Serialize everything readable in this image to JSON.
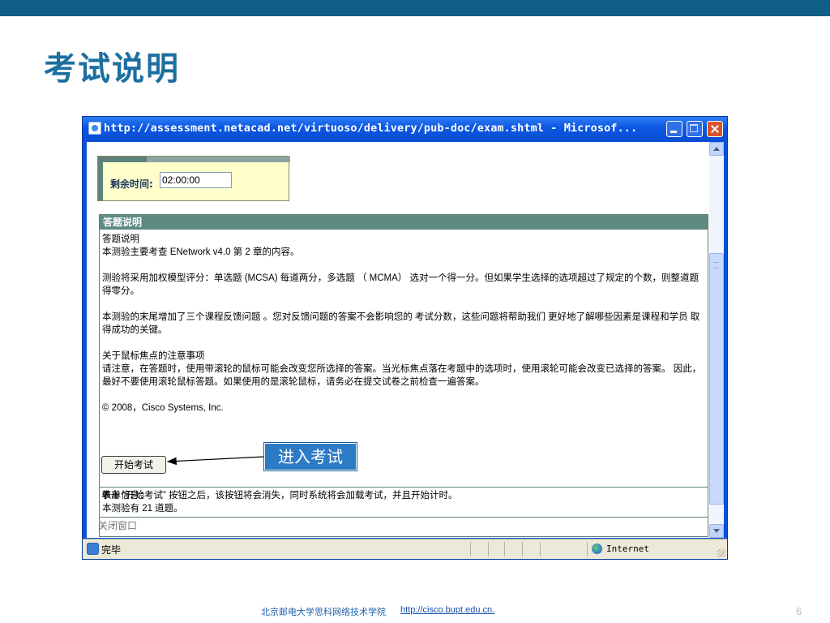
{
  "slide": {
    "title": "考试说明",
    "callout": "进入考试",
    "footer_text": "北京邮电大学思科网络技术学院",
    "footer_link": "http://cisco.bupt.edu.cn.",
    "page_number": "6"
  },
  "window": {
    "title": "http://assessment.netacad.net/virtuoso/delivery/pub-doc/exam.shtml - Microsof...",
    "status_text": "完毕",
    "zone": "Internet"
  },
  "timer": {
    "label": "剩余时间:",
    "value": "02:00:00"
  },
  "instructions": {
    "header": "答题说明",
    "heading": "答题说明",
    "line1": "本测验主要考查  ENetwork v4.0 第  2 章的内容。",
    "para2": "测验将采用加权模型评分：单选题 (MCSA) 每道两分，多选题 （ MCMA） 选对一个得一分。但如果学生选择的选项超过了规定的个数，则整道题得零分。",
    "para3": "本测验的末尾增加了三个课程反馈问题 。您对反馈问题的答案不会影响您的  考试分数，这些问题将帮助我们  更好地了解哪些因素是课程和学员  取得成功的关键。",
    "para4_title": "关于鼠标焦点的注意事项",
    "para4": "请注意，在答题时，使用带滚轮的鼠标可能会改变您所选择的答案。当光标焦点落在考题中的选项时，使用滚轮可能会改变已选择的答案。  因此，最好不要使用滚轮鼠标答题。如果使用的是滚轮鼠标，请务必在提交试卷之前检查一遍答案。",
    "copyright": "© 2008，Cisco Systems, Inc."
  },
  "form_info": {
    "title": "表单信息：",
    "count": "本测验有  21 道题。"
  },
  "start_button": "开始考试",
  "start_note": "单击 “开始考试” 按钮之后，该按钮将会消失，同时系统将会加载考试，并且开始计时。",
  "close_window": "关闭窗口"
}
